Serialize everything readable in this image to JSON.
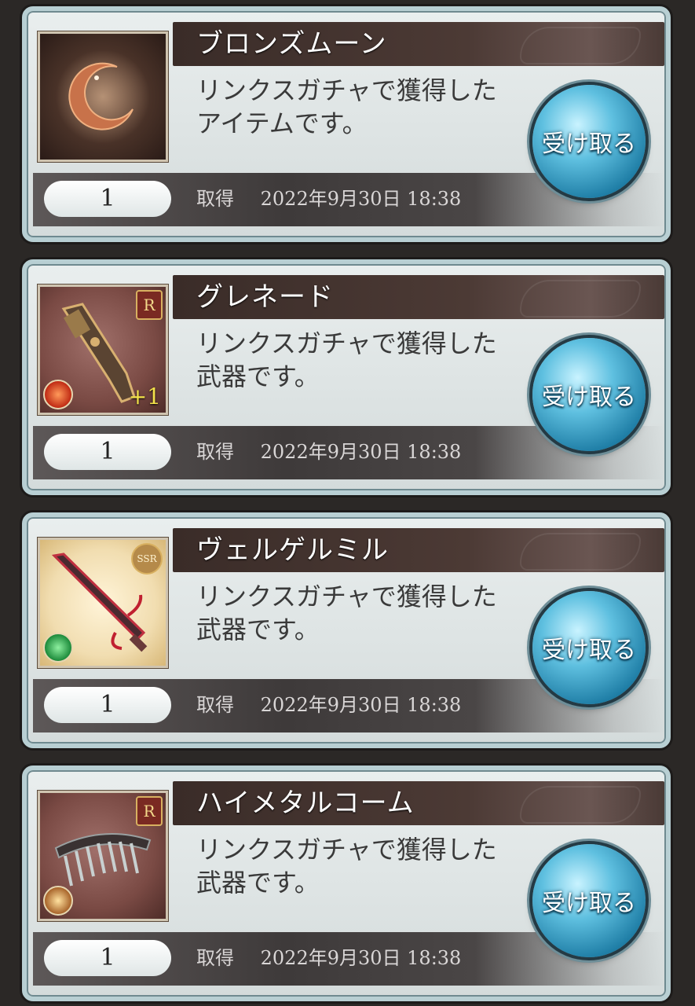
{
  "items": [
    {
      "name": "ブロンズムーン",
      "desc_line1": "リンクスガチャで獲得した",
      "desc_line2": "アイテムです。",
      "quantity": "1",
      "acquired_label": "取得",
      "acquired_time": "2022年9月30日 18:38",
      "receive_label": "受け取る",
      "icon": "bronze-moon-icon"
    },
    {
      "name": "グレネード",
      "desc_line1": "リンクスガチャで獲得した",
      "desc_line2": "武器です。",
      "quantity": "1",
      "acquired_label": "取得",
      "acquired_time": "2022年9月30日 18:38",
      "receive_label": "受け取る",
      "rarity": "R",
      "plus": "+1",
      "element": "fire",
      "icon": "grenade-gun-icon"
    },
    {
      "name": "ヴェルゲルミル",
      "desc_line1": "リンクスガチャで獲得した",
      "desc_line2": "武器です。",
      "quantity": "1",
      "acquired_label": "取得",
      "acquired_time": "2022年9月30日 18:38",
      "receive_label": "受け取る",
      "rarity": "SSR",
      "element": "wind",
      "icon": "sword-icon"
    },
    {
      "name": "ハイメタルコーム",
      "desc_line1": "リンクスガチャで獲得した",
      "desc_line2": "武器です。",
      "quantity": "1",
      "acquired_label": "取得",
      "acquired_time": "2022年9月30日 18:38",
      "receive_label": "受け取る",
      "rarity": "R",
      "element": "light",
      "icon": "comb-icon"
    }
  ]
}
